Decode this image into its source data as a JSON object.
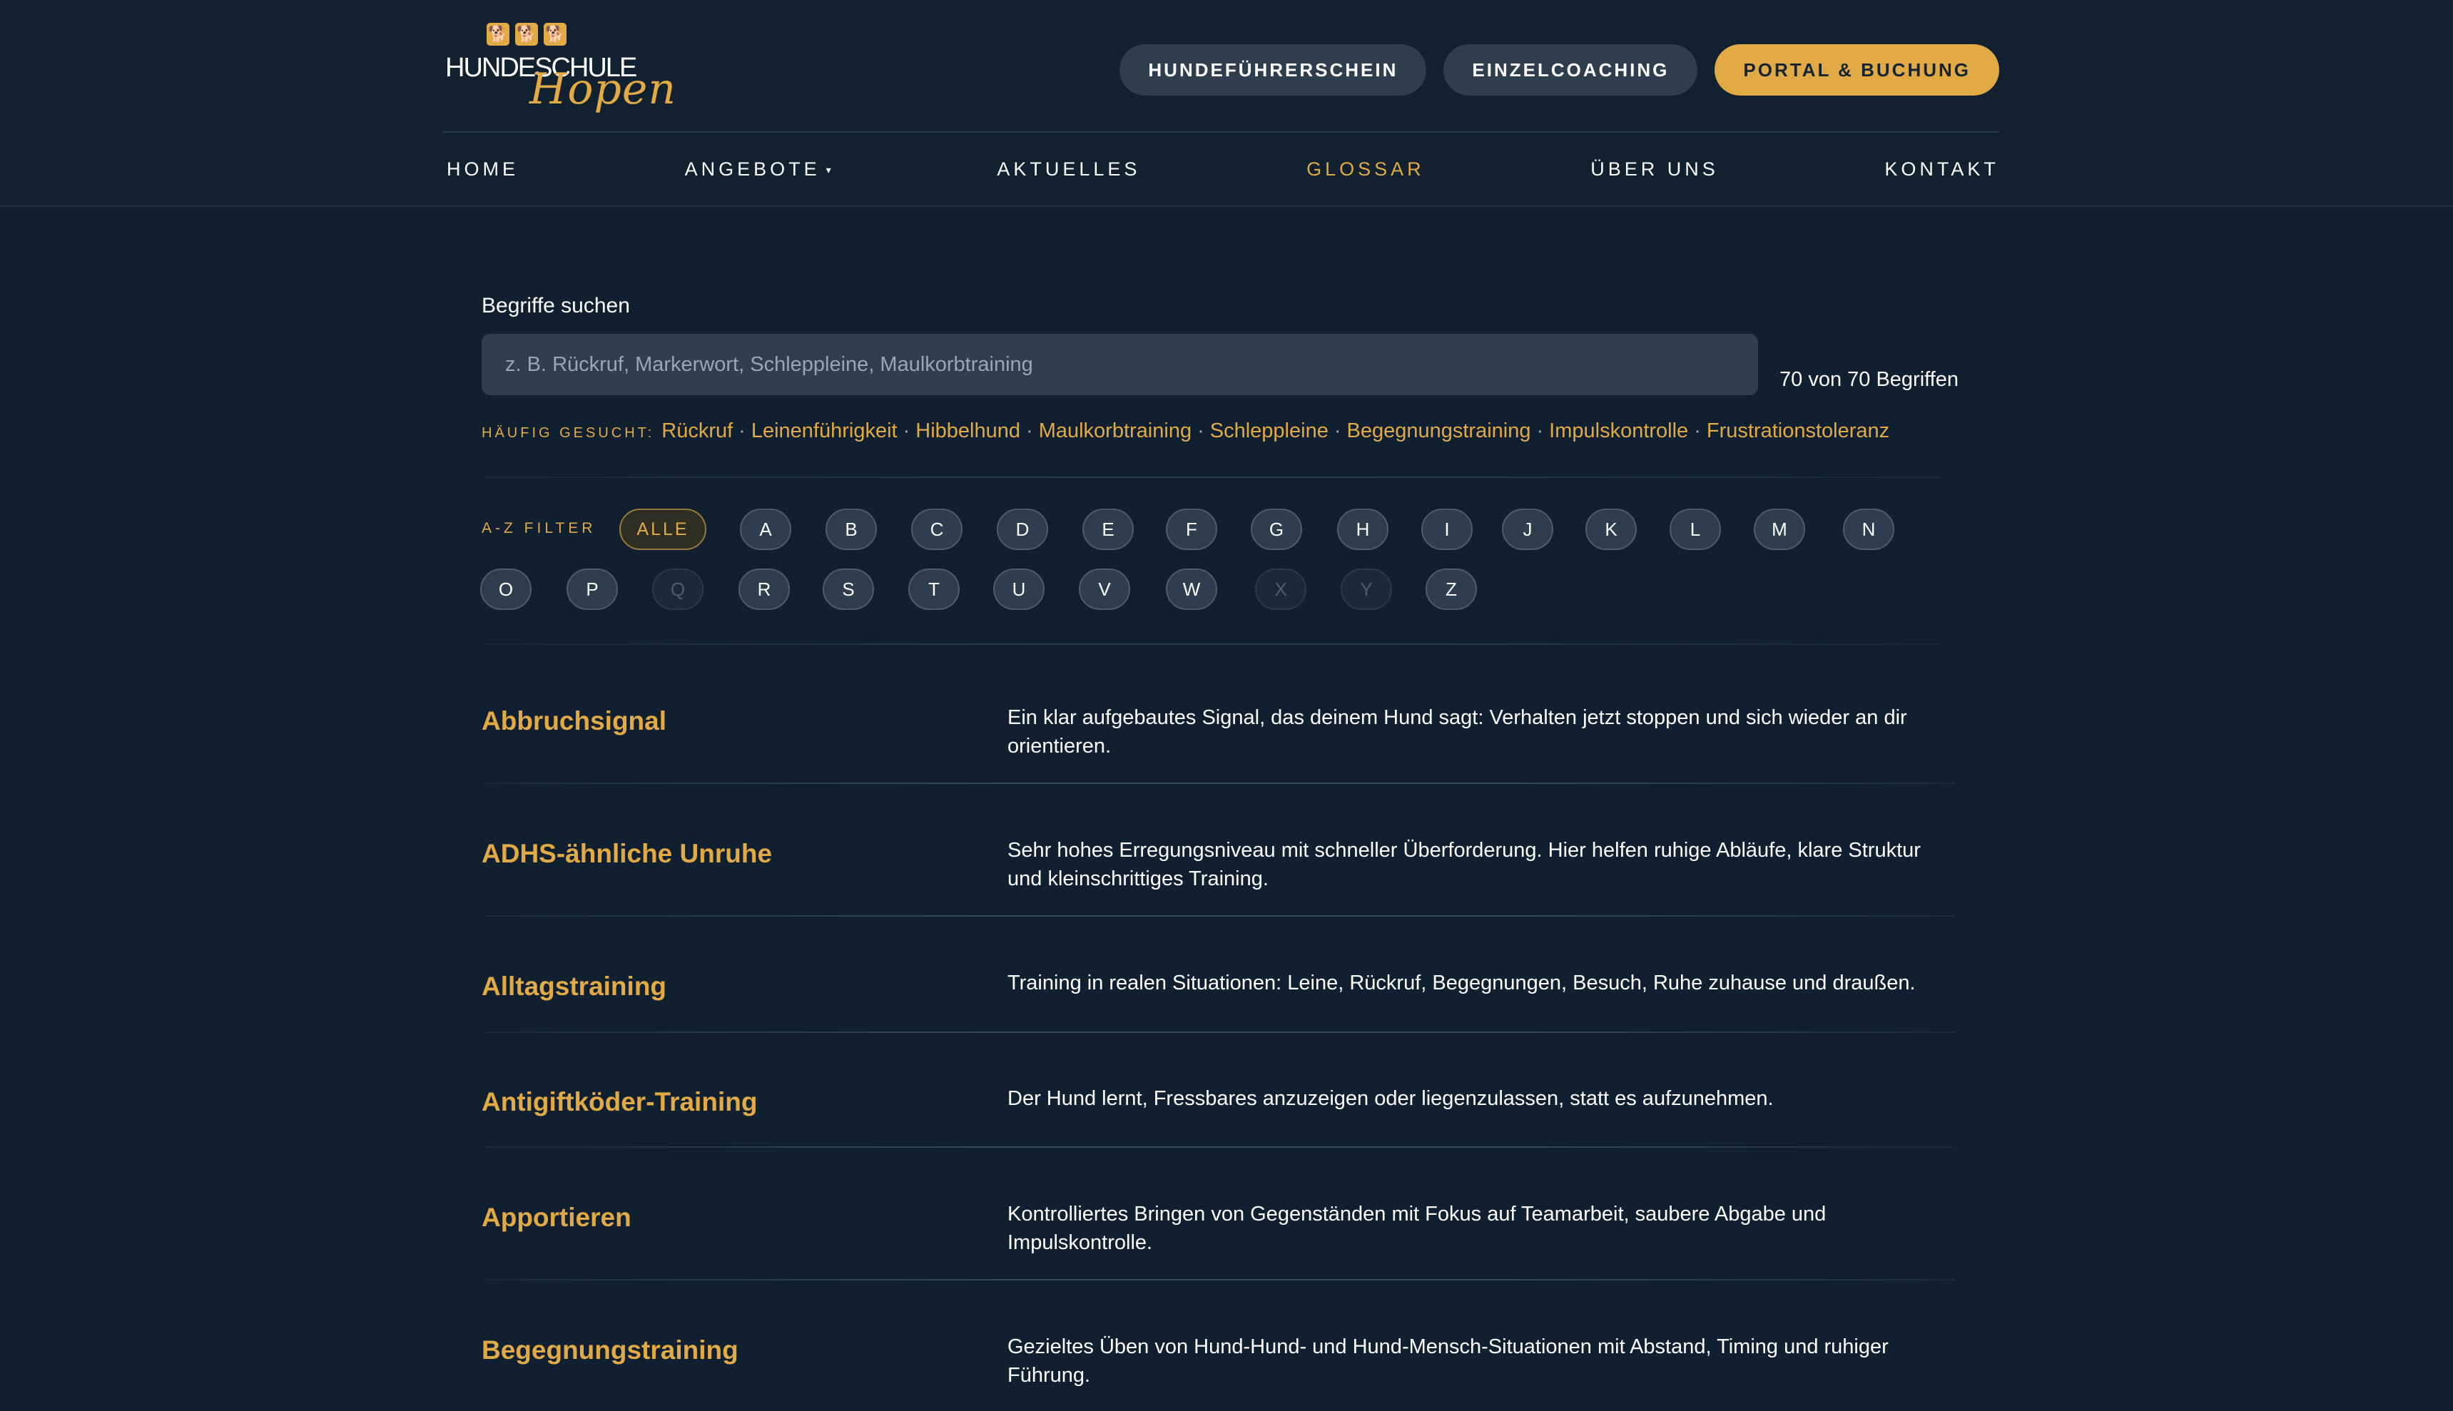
{
  "logo": {
    "line1": "HUNDESCHULE",
    "line2": "Hopen"
  },
  "actions": {
    "license": "HUNDEFÜHRERSCHEIN",
    "coaching": "EINZELCOACHING",
    "portal": "PORTAL & BUCHUNG"
  },
  "nav": {
    "home": "HOME",
    "offers": "ANGEBOTE",
    "news": "AKTUELLES",
    "glossary": "GLOSSAR",
    "about": "ÜBER UNS",
    "contact": "KONTAKT"
  },
  "search": {
    "label": "Begriffe suchen",
    "placeholder": "z. B. Rückruf, Markerwort, Schleppleine, Maulkorbtraining",
    "value": "",
    "count": "70 von 70 Begriffen"
  },
  "popular": {
    "label": "HÄUFIG GESUCHT:",
    "separator": "·",
    "terms": [
      "Rückruf",
      "Leinenführigkeit",
      "Hibbelhund",
      "Maulkorbtraining",
      "Schleppleine",
      "Begegnungstraining",
      "Impulskontrolle",
      "Frustrationstoleranz"
    ]
  },
  "filter": {
    "label": "A-Z FILTER",
    "all": "ALLE",
    "letters": [
      "A",
      "B",
      "C",
      "D",
      "E",
      "F",
      "G",
      "H",
      "I",
      "J",
      "K",
      "L",
      "M",
      "N",
      "O",
      "P",
      "Q",
      "R",
      "S",
      "T",
      "U",
      "V",
      "W",
      "X",
      "Y",
      "Z"
    ],
    "disabled": [
      "Q",
      "X",
      "Y"
    ]
  },
  "glossary": [
    {
      "term": "Abbruchsignal",
      "definition": "Ein klar aufgebautes Signal, das deinem Hund sagt: Verhalten jetzt stoppen und sich wieder an dir orientieren."
    },
    {
      "term": "ADHS-ähnliche Unruhe",
      "definition": "Sehr hohes Erregungsniveau mit schneller Überforderung. Hier helfen ruhige Abläufe, klare Struktur und kleinschrittiges Training."
    },
    {
      "term": "Alltagstraining",
      "definition": "Training in realen Situationen: Leine, Rückruf, Begegnungen, Besuch, Ruhe zuhause und draußen."
    },
    {
      "term": "Antigiftköder-Training",
      "definition": "Der Hund lernt, Fressbares anzuzeigen oder liegenzulassen, statt es aufzunehmen."
    },
    {
      "term": "Apportieren",
      "definition": "Kontrolliertes Bringen von Gegenständen mit Fokus auf Teamarbeit, saubere Abgabe und Impulskontrolle."
    },
    {
      "term": "Begegnungstraining",
      "definition": "Gezieltes Üben von Hund-Hund- und Hund-Mensch-Situationen mit Abstand, Timing und ruhiger Führung."
    }
  ]
}
